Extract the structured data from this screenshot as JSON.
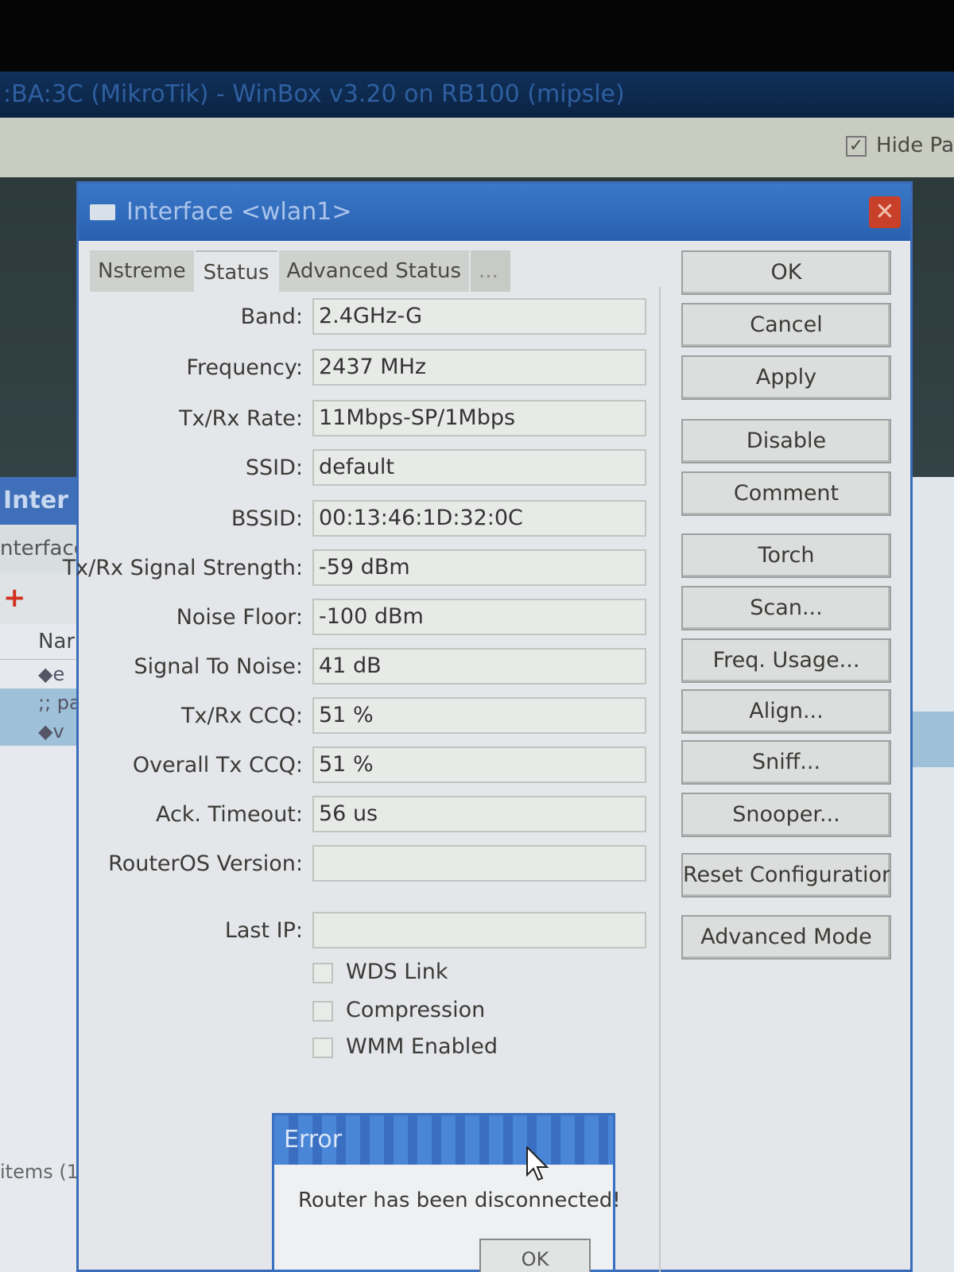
{
  "app": {
    "title": ":BA:3C (MikroTik) - WinBox v3.20 on RB100 (mipsle)",
    "hide_passwords_label": "Hide Pa"
  },
  "background_window": {
    "title": "Inter",
    "tab": "nterface",
    "column_name": "Nar",
    "rows": [
      "◆e",
      ";; pain",
      "◆v"
    ],
    "status": "items (1"
  },
  "dialog": {
    "title": "Interface <wlan1>",
    "close_glyph": "✕",
    "tabs": [
      "Nstreme",
      "Status",
      "Advanced Status",
      "..."
    ],
    "active_tab": "Status",
    "fields": [
      {
        "label": "Band:",
        "value": "2.4GHz-G"
      },
      {
        "label": "Frequency:",
        "value": "2437 MHz"
      },
      {
        "label": "Tx/Rx Rate:",
        "value": "11Mbps-SP/1Mbps"
      },
      {
        "label": "SSID:",
        "value": "default"
      },
      {
        "label": "BSSID:",
        "value": "00:13:46:1D:32:0C"
      },
      {
        "label": "Tx/Rx Signal Strength:",
        "value": "-59 dBm"
      },
      {
        "label": "Noise Floor:",
        "value": "-100 dBm"
      },
      {
        "label": "Signal To Noise:",
        "value": "41 dB"
      },
      {
        "label": "Tx/Rx CCQ:",
        "value": "51 %"
      },
      {
        "label": "Overall Tx CCQ:",
        "value": "51 %"
      },
      {
        "label": "Ack. Timeout:",
        "value": "56 us"
      },
      {
        "label": "RouterOS Version:",
        "value": ""
      },
      {
        "label": "Last IP:",
        "value": ""
      }
    ],
    "checkboxes": [
      {
        "label": "WDS Link",
        "checked": false
      },
      {
        "label": "Compression",
        "checked": false
      },
      {
        "label": "WMM Enabled",
        "checked": false
      }
    ],
    "buttons": [
      "OK",
      "Cancel",
      "Apply",
      "Disable",
      "Comment",
      "Torch",
      "Scan...",
      "Freq. Usage...",
      "Align...",
      "Sniff...",
      "Snooper...",
      "Reset Configuration",
      "Advanced Mode"
    ]
  },
  "error_dialog": {
    "title": "Error",
    "message": "Router has been disconnected!",
    "ok_label": "OK"
  },
  "colors": {
    "titlebar_blue": "#2a60b0",
    "dialog_bg": "#e4e6e9",
    "close_red": "#c8402a"
  }
}
